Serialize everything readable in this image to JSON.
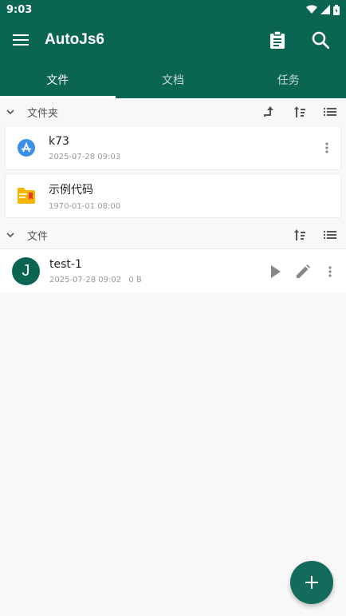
{
  "status_bar": {
    "time": "9:03"
  },
  "app_bar": {
    "title": "AutoJs6",
    "menu_icon": "menu-icon",
    "clipboard_icon": "clipboard-icon",
    "search_icon": "search-icon"
  },
  "tabs": [
    {
      "label": "文件",
      "active": true
    },
    {
      "label": "文档",
      "active": false
    },
    {
      "label": "任务",
      "active": false
    }
  ],
  "folders_section": {
    "label": "文件夹"
  },
  "folders": [
    {
      "name": "k73",
      "date": "2025-07-28 09:03",
      "icon": "app-store-icon"
    },
    {
      "name": "示例代码",
      "date": "1970-01-01 08:00",
      "icon": "folder-icon"
    }
  ],
  "files_section": {
    "label": "文件"
  },
  "files": [
    {
      "avatar_letter": "J",
      "name": "test-1",
      "date": "2025-07-28 09:02",
      "size": "0 B"
    }
  ],
  "fab": {
    "icon": "plus-icon"
  },
  "colors": {
    "primary": "#0b6553",
    "accent": "#136b5b",
    "background": "#f8f8f8"
  }
}
